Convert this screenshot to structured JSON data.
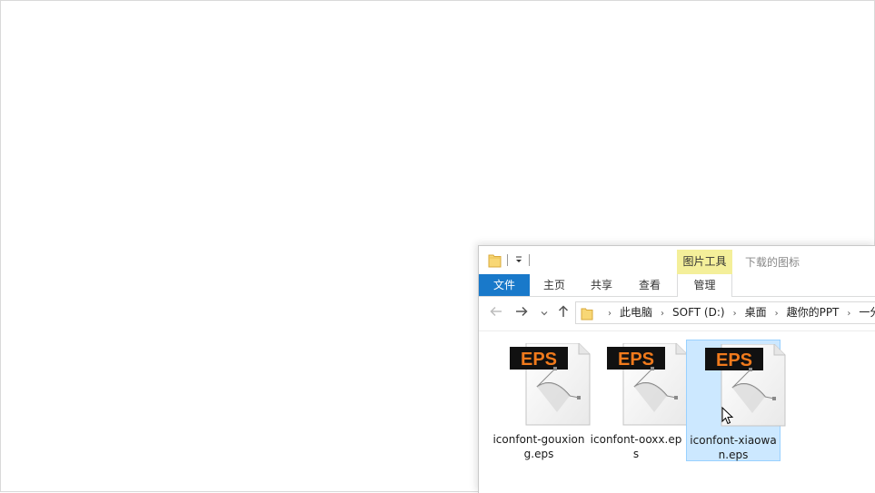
{
  "window": {
    "title": "下载的图标",
    "context_group": "图片工具"
  },
  "ribbon": {
    "tabs": [
      "文件",
      "主页",
      "共享",
      "查看",
      "管理"
    ]
  },
  "address": {
    "crumbs": [
      "此电脑",
      "SOFT (D:)",
      "桌面",
      "趣你的PPT",
      "一分"
    ]
  },
  "files": [
    {
      "name": "iconfont-gouxiong.eps",
      "badge": "EPS",
      "selected": false
    },
    {
      "name": "iconfont-ooxx.eps",
      "badge": "EPS",
      "selected": false
    },
    {
      "name": "iconfont-xiaowan.eps",
      "badge": "EPS",
      "selected": true
    }
  ],
  "icons": {
    "folder": "folder-icon",
    "quick_access_dropdown": "dropdown-arrow-icon",
    "back": "back-arrow-icon",
    "forward": "forward-arrow-icon",
    "recent": "chevron-down-icon",
    "up": "up-arrow-icon",
    "file_type": "eps-file-icon",
    "cursor": "mouse-cursor-icon"
  },
  "colors": {
    "file_tab": "#1979ca",
    "context_group": "#f4ef9a",
    "selection_fill": "#cce8ff",
    "selection_border": "#99d1ff",
    "eps_badge_bg": "#111111",
    "eps_badge_text": "#f07a1c"
  }
}
